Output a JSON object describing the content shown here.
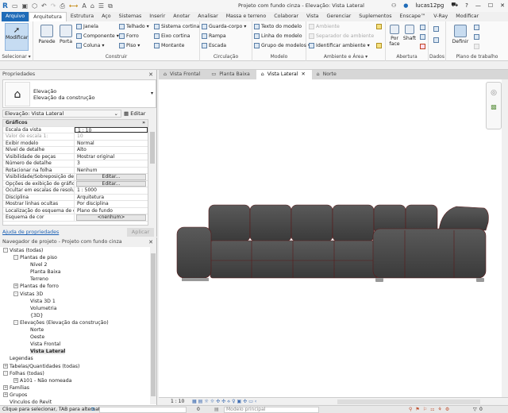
{
  "titlebar": {
    "title": "Projeto com fundo cinza - Elevação: Vista Lateral",
    "user": "lucas12pg"
  },
  "menu": {
    "tabs": [
      "Arquivo",
      "Arquitetura",
      "Estrutura",
      "Aço",
      "Sistemas",
      "Inserir",
      "Anotar",
      "Analisar",
      "Massa e terreno",
      "Colaborar",
      "Vista",
      "Gerenciar",
      "Suplementos",
      "Enscape™",
      "V-Ray",
      "Modificar"
    ],
    "active": "Arquitetura"
  },
  "ribbon": {
    "selecionar": {
      "modificar": "Modificar",
      "label": "Selecionar ▾"
    },
    "construir": {
      "parede": "Parede",
      "porta": "Porta",
      "janela": "Janela",
      "componente": "Componente ▾",
      "coluna": "Coluna ▾",
      "telhado": "Telhado ▾",
      "forro": "Forro",
      "piso": "Piso ▾",
      "sistema_cortina": "Sistema cortina",
      "eixo_cortina": "Eixo cortina",
      "montante": "Montante",
      "label": "Construir"
    },
    "circulacao": {
      "guarda_corpo": "Guarda-corpo ▾",
      "rampa": "Rampa",
      "escada": "Escada",
      "label": "Circulação"
    },
    "modelo": {
      "texto": "Texto do modelo",
      "linha": "Linha do modelo",
      "grupo": "Grupo de modelos ▾",
      "label": "Modelo"
    },
    "ambiente": {
      "ambiente": "Ambiente",
      "separador": "Separador de ambiente",
      "identificar": "Identificar ambiente ▾",
      "label": "Ambiente e Área ▾"
    },
    "abertura": {
      "por_face": "Por face",
      "shaft": "Shaft",
      "label": "Abertura"
    },
    "dados": {
      "label": "Dados"
    },
    "plano": {
      "definir": "Definir",
      "label": "Plano de trabalho"
    }
  },
  "properties": {
    "title": "Propriedades",
    "type_family": "Elevação",
    "type_name": "Elevação da construção",
    "instance": "Elevação: Vista Lateral",
    "edit_type": "Editar tipo",
    "category": "Gráficos",
    "rows": [
      {
        "k": "Escala da vista",
        "v": "1 : 10"
      },
      {
        "k": "Valor de escala    1:",
        "v": "10"
      },
      {
        "k": "Exibir modelo",
        "v": "Normal"
      },
      {
        "k": "Nível de detalhe",
        "v": "Alto"
      },
      {
        "k": "Visibilidade de peças",
        "v": "Mostrar original"
      },
      {
        "k": "Número de detalhe",
        "v": "3"
      },
      {
        "k": "Rotacionar na folha",
        "v": "Nenhum"
      },
      {
        "k": "Visibilidade/Sobreposição de ...",
        "v": "Editar..."
      },
      {
        "k": "Opções de exibição de gráficos",
        "v": "Editar..."
      },
      {
        "k": "Ocultar em escalas de resoluç...",
        "v": "1 : 5000"
      },
      {
        "k": "Disciplina",
        "v": "Arquitetura"
      },
      {
        "k": "Mostrar linhas ocultas",
        "v": "Por disciplina"
      },
      {
        "k": "Localização do esquema de cor",
        "v": "Plano de fundo"
      },
      {
        "k": "Esquema de cor",
        "v": "<nenhum>"
      }
    ],
    "help": "Ajuda de propriedades",
    "apply": "Aplicar"
  },
  "browser": {
    "title": "Navegador de projeto - Projeto com fundo cinza",
    "nodes": [
      {
        "label": "Vistas (todas)",
        "level": 0,
        "exp": "-"
      },
      {
        "label": "Plantas de piso",
        "level": 1,
        "exp": "-"
      },
      {
        "label": "Nível 2",
        "level": 2
      },
      {
        "label": "Planta Baixa",
        "level": 2
      },
      {
        "label": "Terreno",
        "level": 2
      },
      {
        "label": "Plantas de forro",
        "level": 1,
        "exp": "+"
      },
      {
        "label": "Vistas 3D",
        "level": 1,
        "exp": "-"
      },
      {
        "label": "Vista 3D 1",
        "level": 2
      },
      {
        "label": "Volumetria",
        "level": 2
      },
      {
        "label": "{3D}",
        "level": 2
      },
      {
        "label": "Elevações (Elevação da construção)",
        "level": 1,
        "exp": "-"
      },
      {
        "label": "Norte",
        "level": 2
      },
      {
        "label": "Oeste",
        "level": 2
      },
      {
        "label": "Vista Frontal",
        "level": 2
      },
      {
        "label": "Vista Lateral",
        "level": 2,
        "selected": true
      },
      {
        "label": "Legendas",
        "level": 0
      },
      {
        "label": "Tabelas/Quantidades (todas)",
        "level": 0,
        "exp": "+"
      },
      {
        "label": "Folhas (todas)",
        "level": 0,
        "exp": "-"
      },
      {
        "label": "A101 - Não nomeada",
        "level": 1,
        "exp": "+"
      },
      {
        "label": "Famílias",
        "level": 0,
        "exp": "+"
      },
      {
        "label": "Grupos",
        "level": 0,
        "exp": "+"
      },
      {
        "label": "Vínculos do Revit",
        "level": 0
      }
    ]
  },
  "view_tabs": [
    {
      "label": "Vista Frontal",
      "icon": "elevation-icon"
    },
    {
      "label": "Planta Baixa",
      "icon": "plan-icon"
    },
    {
      "label": "Vista Lateral",
      "icon": "elevation-icon",
      "active": true
    },
    {
      "label": "Norte",
      "icon": "elevation-icon"
    }
  ],
  "view_control": {
    "scale": "1 : 10"
  },
  "statusbar": {
    "hint": "Clique para selecionar, TAB para alternat",
    "count": "0",
    "model": "Modelo principal",
    "filter_count": "0"
  },
  "colors": {
    "accent": "#1e6bb8",
    "sofa": "#4a4a4a"
  }
}
